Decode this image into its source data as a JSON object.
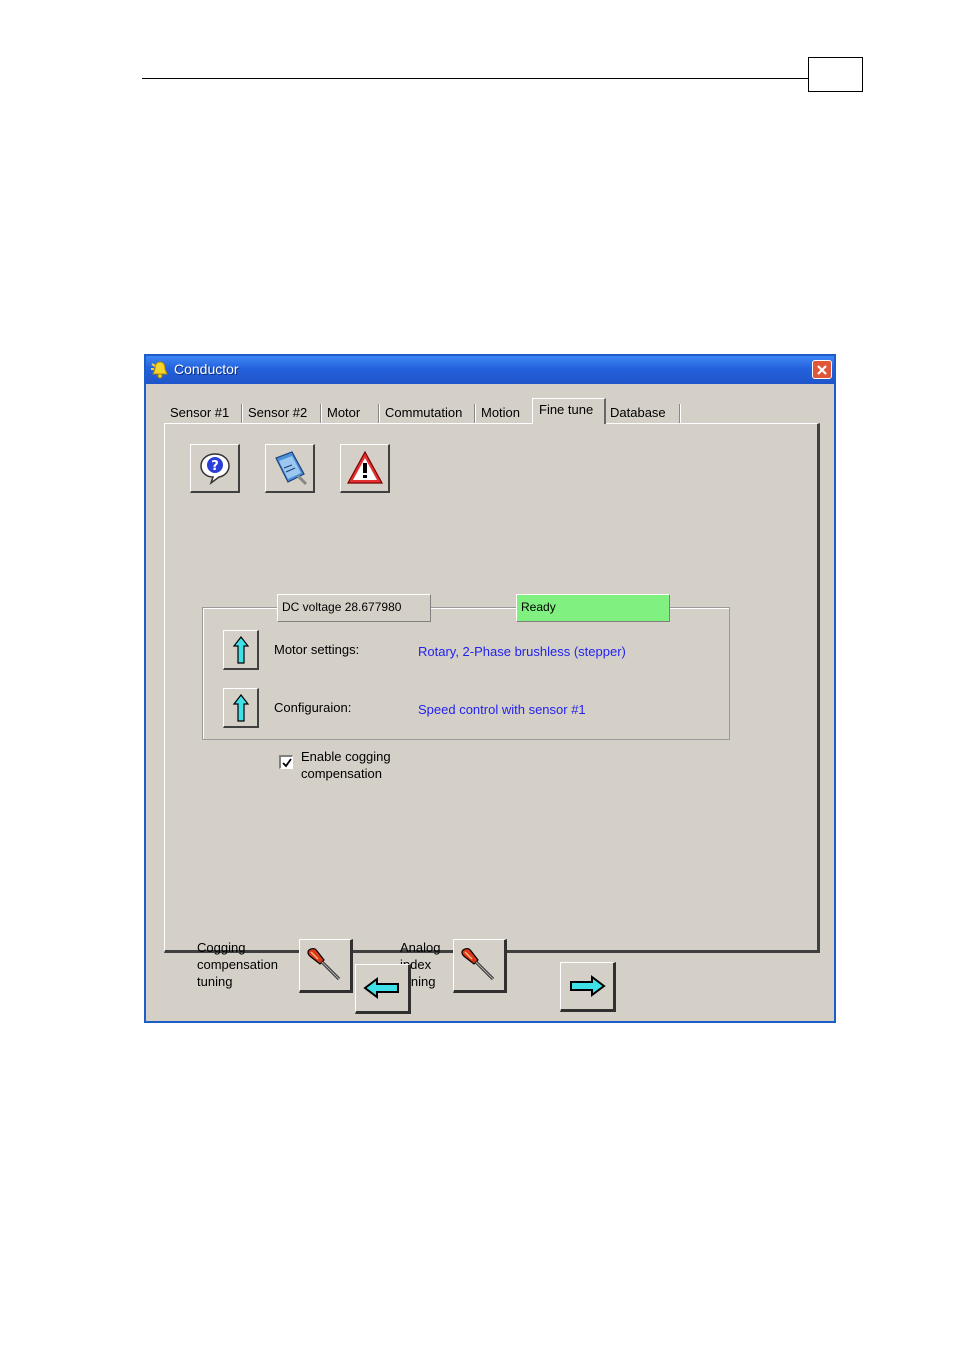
{
  "window": {
    "title": "Conductor",
    "icons": {
      "app": "bell-icon",
      "close": "close-icon"
    }
  },
  "tabs": [
    {
      "label": "Sensor #1"
    },
    {
      "label": "Sensor #2"
    },
    {
      "label": "Motor"
    },
    {
      "label": "Commutation"
    },
    {
      "label": "Motion"
    },
    {
      "label": "Fine tune",
      "active": true
    },
    {
      "label": "Database"
    }
  ],
  "toolbar": {
    "icons": [
      "help-icon",
      "manual-icon",
      "warning-icon"
    ]
  },
  "status": {
    "dc_voltage": "DC voltage 28.677980",
    "state": "Ready",
    "state_color": "#80f080"
  },
  "settings": {
    "motor_label": "Motor settings:",
    "motor_value": "Rotary, 2-Phase brushless (stepper)",
    "config_label": "Configuraion:",
    "config_value": "Speed control with sensor #1"
  },
  "cogging": {
    "checkbox_line1": "Enable cogging",
    "checkbox_line2": "compensation",
    "checked": true
  },
  "tuning": {
    "cogging_line1": "Cogging",
    "cogging_line2": "compensation",
    "cogging_line3": "tuning",
    "analog_line1": "Analog",
    "analog_line2": "index",
    "analog_line3": "tuning"
  },
  "navigation": {
    "icons": [
      "arrow-left-icon",
      "arrow-right-icon"
    ]
  }
}
